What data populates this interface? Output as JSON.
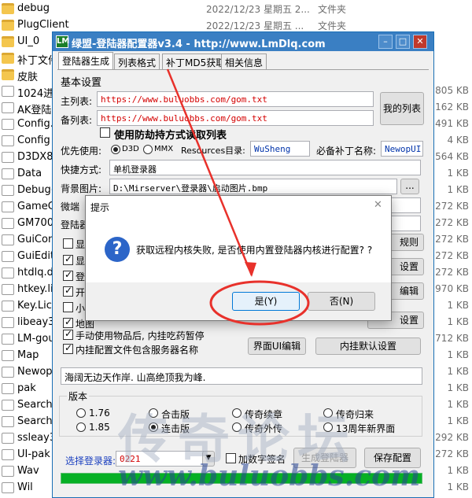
{
  "explorer": {
    "files": [
      {
        "name": "debug",
        "date": "2022/12/23 星期五 2...",
        "type": "文件夹",
        "size": "",
        "icon": "folder-icon"
      },
      {
        "name": "PlugClient",
        "date": "2022/12/23 星期五 ...",
        "type": "文件夹",
        "size": "",
        "icon": "folder-icon"
      },
      {
        "name": "UI_0",
        "date": "",
        "type": "",
        "size": "",
        "icon": "folder-icon"
      },
      {
        "name": "补丁文件",
        "date": "",
        "type": "",
        "size": "",
        "icon": "folder-icon"
      },
      {
        "name": "皮肤",
        "date": "",
        "type": "",
        "size": "",
        "icon": "folder-icon"
      },
      {
        "name": "1024进",
        "date": "",
        "type": "",
        "size": "805 KB",
        "icon": "file-icon"
      },
      {
        "name": "AK登陆",
        "date": "",
        "type": "",
        "size": "162 KB",
        "icon": "file-icon"
      },
      {
        "name": "Config.",
        "date": "",
        "type": "",
        "size": "491 KB",
        "icon": "file-icon"
      },
      {
        "name": "Config",
        "date": "",
        "type": "",
        "size": "4 KB",
        "icon": "file-icon"
      },
      {
        "name": "D3DX8",
        "date": "",
        "type": "",
        "size": "564 KB",
        "icon": "file-icon"
      },
      {
        "name": "Data",
        "date": "",
        "type": "",
        "size": "1 KB",
        "icon": "file-icon"
      },
      {
        "name": "Debug(",
        "date": "",
        "type": "",
        "size": "1 KB",
        "icon": "file-icon"
      },
      {
        "name": "GameC",
        "date": "",
        "type": "",
        "size": "272 KB",
        "icon": "file-icon"
      },
      {
        "name": "GM700",
        "date": "",
        "type": "",
        "size": "272 KB",
        "icon": "file-icon"
      },
      {
        "name": "GuiCon",
        "date": "",
        "type": "",
        "size": "272 KB",
        "icon": "file-icon"
      },
      {
        "name": "GuiEdit",
        "date": "",
        "type": "",
        "size": "272 KB",
        "icon": "file-icon"
      },
      {
        "name": "htdlq.d",
        "date": "",
        "type": "",
        "size": "272 KB",
        "icon": "file-icon"
      },
      {
        "name": "htkey.li",
        "date": "",
        "type": "",
        "size": "970 KB",
        "icon": "file-icon"
      },
      {
        "name": "Key.Lic",
        "date": "",
        "type": "",
        "size": "1 KB",
        "icon": "file-icon"
      },
      {
        "name": "libeay3",
        "date": "",
        "type": "",
        "size": "1 KB",
        "icon": "file-icon"
      },
      {
        "name": "LM-gou",
        "date": "",
        "type": "",
        "size": "712 KB",
        "icon": "file-icon"
      },
      {
        "name": "Map",
        "date": "",
        "type": "",
        "size": "1 KB",
        "icon": "file-icon"
      },
      {
        "name": "Newop",
        "date": "",
        "type": "",
        "size": "1 KB",
        "icon": "file-icon"
      },
      {
        "name": "pak",
        "date": "",
        "type": "",
        "size": "1 KB",
        "icon": "file-icon"
      },
      {
        "name": "SearchI",
        "date": "",
        "type": "",
        "size": "1 KB",
        "icon": "file-icon"
      },
      {
        "name": "Search",
        "date": "",
        "type": "",
        "size": "1 KB",
        "icon": "file-icon"
      },
      {
        "name": "ssleay3",
        "date": "",
        "type": "",
        "size": "292 KB",
        "icon": "file-icon"
      },
      {
        "name": "UI-pak",
        "date": "",
        "type": "",
        "size": "272 KB",
        "icon": "file-icon"
      },
      {
        "name": "Wav",
        "date": "",
        "type": "",
        "size": "1 KB",
        "icon": "file-icon"
      },
      {
        "name": "Wil",
        "date": "",
        "type": "",
        "size": "1 KB",
        "icon": "file-icon"
      }
    ]
  },
  "window": {
    "title": "绿盟-登陆器配置器v3.4 - http://www.LmDlq.com",
    "icon_text": "LM",
    "tabs": [
      "登陆器生成",
      "列表格式",
      "补丁MD5获取",
      "相关信息"
    ],
    "section_basic": "基本设置",
    "main_list_label": "主列表:",
    "main_list_value": "https://www.buluobbs.com/gom.txt",
    "backup_list_label": "备列表:",
    "backup_list_value": "https://www.buluobbs.com/gom.txt",
    "my_list_button": "我的列表",
    "anti_hijack_label": "使用防劫持方式读取列表",
    "priority_label": "优先使用:",
    "radio_d3d": "D3D",
    "radio_mmx": "MMX",
    "resources_label": "Resources目录:",
    "resources_value": "WuSheng",
    "patch_label": "必备补丁名称:",
    "patch_value": "NewopUI",
    "shortcut_label": "快捷方式:",
    "shortcut_value": "单机登录器",
    "bg_label": "背景图片:",
    "bg_value": "D:\\Mirserver\\登录器\\启动图片.bmp",
    "browse_button": "...",
    "micro_label": "微端",
    "login_label": "登陆器",
    "left_checks": [
      "显示",
      "显示",
      "登陆",
      "开始",
      "小",
      "地图"
    ],
    "right_buttons": [
      "规则",
      "设置",
      "编辑",
      "设置"
    ],
    "check_item_use": "手动使用物品后, 内挂吃药暂停",
    "check_server_name": "内挂配置文件包含服务器名称",
    "ui_edit_button": "界面UI编辑",
    "internal_default_button": "内挂默认设置",
    "slogan_value": "海阔无边天作岸. 山高绝顶我为峰.",
    "version_label": "版本",
    "versions": [
      "1.76",
      "合击版",
      "传奇续章",
      "传奇归来",
      "1.85",
      "连击版",
      "传奇外传",
      "13周年新界面"
    ],
    "select_login_label": "选择登录器:",
    "select_login_value": "0221",
    "digital_sign_label": "加数字签名",
    "generate_button": "生成登陆器",
    "save_button": "保存配置"
  },
  "dialog": {
    "title": "提示",
    "message": "获取远程内核失败, 是否使用内置登陆器内核进行配置? ?",
    "yes_button": "是(Y)",
    "no_button": "否(N)",
    "close_glyph": "✕"
  },
  "watermark": {
    "chinese": "传奇论坛",
    "url": "www.buluobbs.com"
  },
  "colors": {
    "annotation_red": "#e8312b",
    "progress_green": "#06b025",
    "title_blue": "#3a7fc3"
  }
}
